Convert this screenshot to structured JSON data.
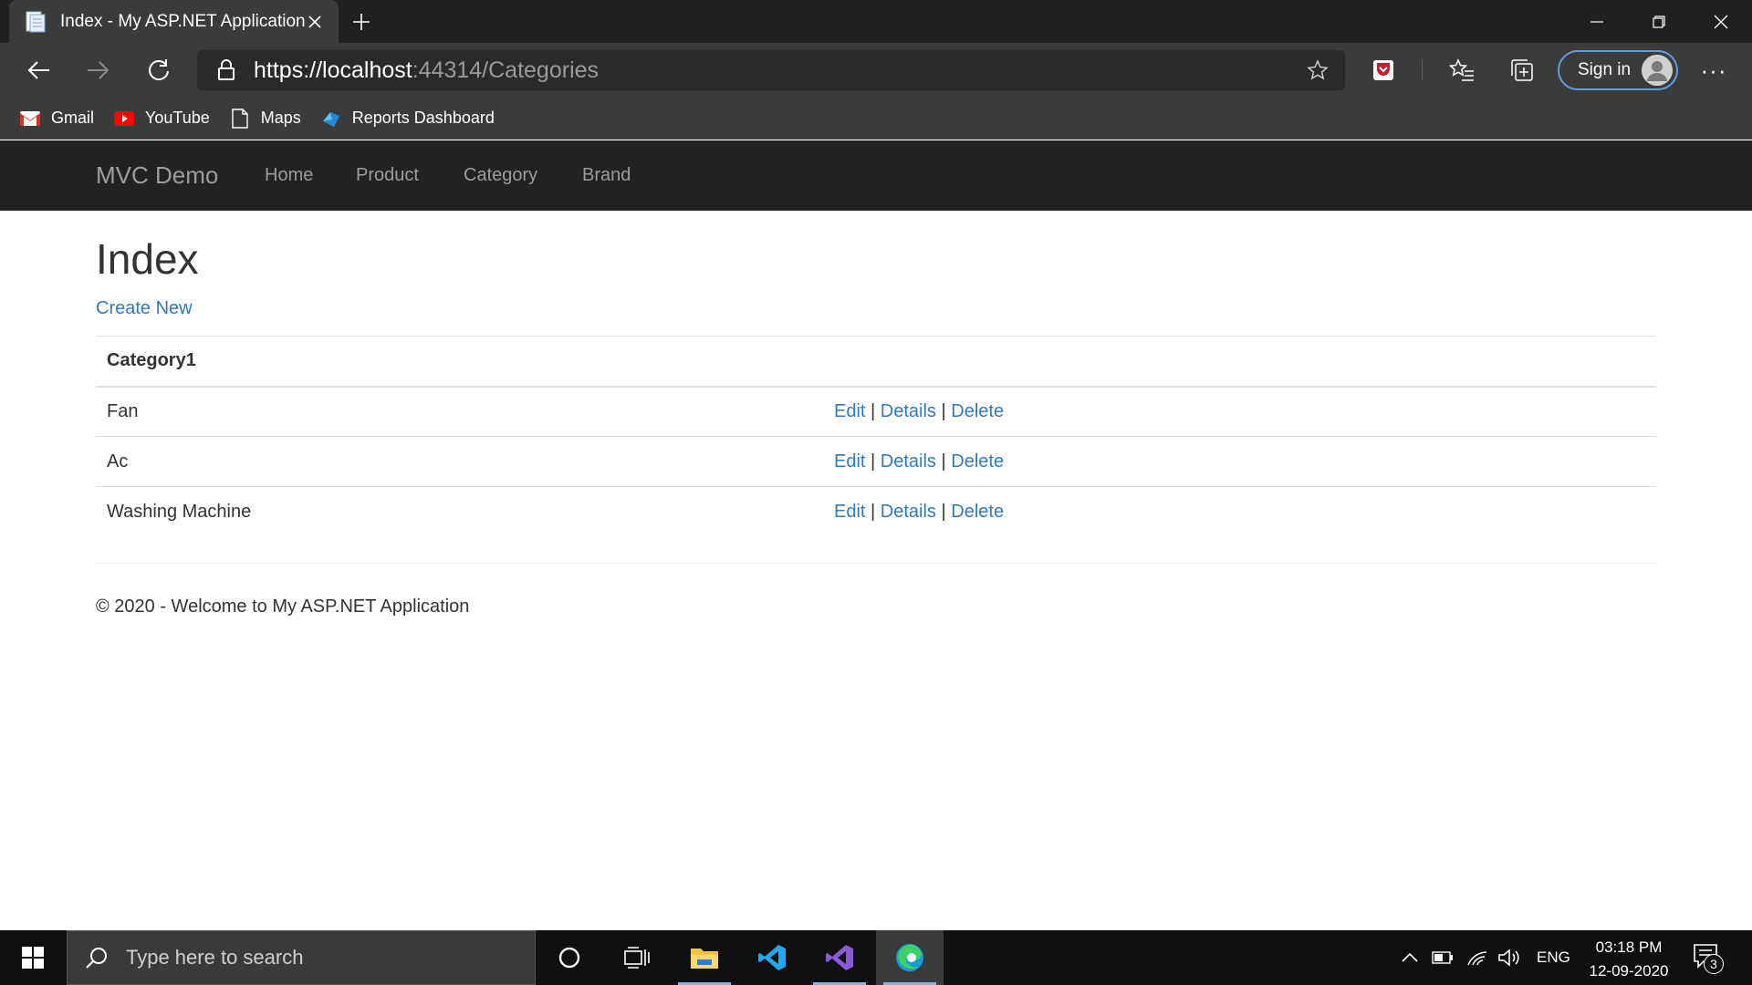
{
  "browser": {
    "tab_title": "Index - My ASP.NET Application",
    "url_scheme": "https://",
    "url_host": "localhost",
    "url_rest": ":44314/Categories",
    "signin_label": "Sign in",
    "more_label": "···",
    "bookmarks": [
      {
        "label": "Gmail",
        "icon": "gmail-icon"
      },
      {
        "label": "YouTube",
        "icon": "youtube-icon"
      },
      {
        "label": "Maps",
        "icon": "page-icon"
      },
      {
        "label": "Reports Dashboard",
        "icon": "power-bi-icon"
      }
    ]
  },
  "site": {
    "brand": "MVC Demo",
    "nav": [
      "Home",
      "Product",
      "Category",
      "Brand"
    ],
    "page_title": "Index",
    "create_new": "Create New",
    "table": {
      "header": "Category1",
      "rows": [
        "Fan",
        "Ac",
        "Washing Machine"
      ],
      "actions": {
        "edit": "Edit",
        "details": "Details",
        "delete": "Delete",
        "separator": "|"
      }
    },
    "footer": "© 2020 - Welcome to My ASP.NET Application"
  },
  "taskbar": {
    "search_placeholder": "Type here to search",
    "language": "ENG",
    "time": "03:18 PM",
    "date": "12-09-2020",
    "notification_count": "3"
  },
  "colors": {
    "link": "#337ab7",
    "navbar": "#222222",
    "browser_chrome": "#3b3b3b",
    "titlebar": "#202020",
    "taskbar": "#101010"
  }
}
